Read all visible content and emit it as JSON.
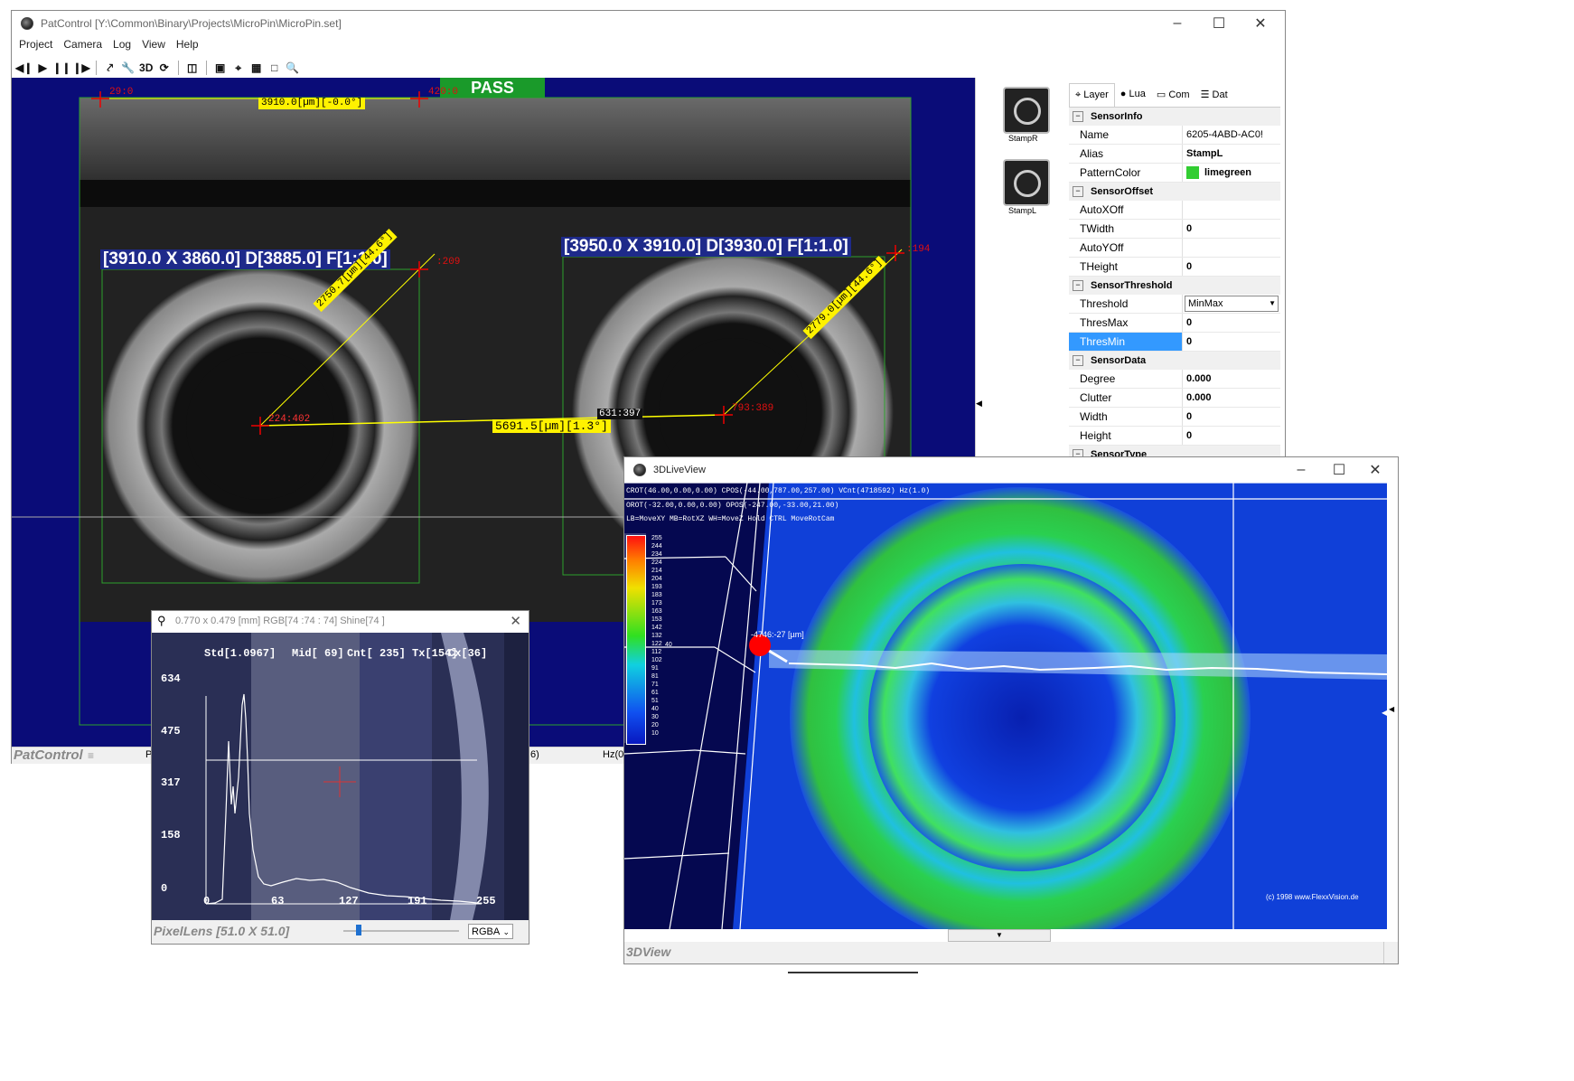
{
  "main_window": {
    "title": "PatControl [Y:\\Common\\Binary\\Projects\\MicroPin\\MicroPin.set]",
    "menu": [
      "Project",
      "Camera",
      "Log",
      "View",
      "Help"
    ],
    "toolbar": [
      "3D"
    ],
    "status_badge": "PASS",
    "status_color": "#1a9a2a",
    "top_measure": "3910.0[µm][-0.0°]",
    "point_left_top": "29:0",
    "point_right_top": "420:0",
    "left_pin_dims": "[3910.0 X 3860.0] D[3885.0] F[1:1.0]",
    "right_pin_dims": "[3950.0 X 3910.0] D[3930.0] F[1:1.0]",
    "left_radius": "2750.7[µm][44.6°]",
    "right_radius": "2779.0[µm][44.6°]",
    "center_dist": "5691.5[µm][1.3°]",
    "left_center": "224:402",
    "right_center": "793:389",
    "mid_point": "631:397",
    "left_edge_pt": ":209",
    "right_edge_pt": ":194",
    "statusbar_app": "PatControl",
    "statusbar_p": "P",
    "statusbar_mid": "6)",
    "statusbar_hz": "Hz(0."
  },
  "thumbnails": [
    {
      "label": "StampR"
    },
    {
      "label": "StampL"
    }
  ],
  "properties": {
    "tabs": [
      "Layer",
      "Lua",
      "Com",
      "Dat"
    ],
    "categories": [
      {
        "name": "SensorInfo",
        "rows": [
          {
            "k": "Name",
            "v": "6205-4ABD-AC0!"
          },
          {
            "k": "Alias",
            "v": "StampL"
          },
          {
            "k": "PatternColor",
            "v": "limegreen"
          }
        ]
      },
      {
        "name": "SensorOffset",
        "rows": [
          {
            "k": "AutoXOff",
            "v": ""
          },
          {
            "k": "TWidth",
            "v": "0"
          },
          {
            "k": "AutoYOff",
            "v": ""
          },
          {
            "k": "THeight",
            "v": "0"
          }
        ]
      },
      {
        "name": "SensorThreshold",
        "rows": [
          {
            "k": "Threshold",
            "v": "MinMax"
          },
          {
            "k": "ThresMax",
            "v": "0"
          },
          {
            "k": "ThresMin",
            "v": "0"
          }
        ]
      },
      {
        "name": "SensorData",
        "rows": [
          {
            "k": "Degree",
            "v": "0.000"
          },
          {
            "k": "Clutter",
            "v": "0.000"
          },
          {
            "k": "Width",
            "v": "0"
          },
          {
            "k": "Height",
            "v": "0"
          }
        ]
      },
      {
        "name": "SensorType",
        "rows": []
      }
    ],
    "pattern_color_hex": "#32cd32"
  },
  "pixel_lens": {
    "title": "0.770 x 0.479 [mm] RGB[74 :74 : 74] Shine[74 ]",
    "stats": {
      "std": "Std[1.0967]",
      "mid": "Mid[ 69]",
      "cnt": "Cnt[ 235] Tx[154]",
      "cx": "Cx[36]"
    },
    "y_ticks": [
      "634",
      "475",
      "317",
      "158",
      "0"
    ],
    "x_ticks": [
      "0",
      "63",
      "127",
      "191",
      "255"
    ],
    "statusbar": "PixelLens  [51.0 X 51.0]",
    "mode": "RGBA"
  },
  "live3d": {
    "title": "3DLiveView",
    "info1": "CROT(46.00,0.00,0.00) CPOS(-44.00,787.00,257.00) VCnt(4718592) Hz(1.0)",
    "info2": "OROT(-32.00,0.00,0.00) OPOS(-247.00,-33.00,21.00)",
    "info3": "LB=MoveXY MB=RotXZ WH=MoveZ Hold CTRL MoveRotCam",
    "probe": "-4746:-27 [µm]",
    "scale_values": [
      "255",
      "244",
      "234",
      "224",
      "214",
      "204",
      "193",
      "183",
      "173",
      "163",
      "153",
      "142",
      "132",
      "122",
      "112",
      "102",
      "91",
      "81",
      "71",
      "61",
      "51",
      "40",
      "30",
      "20",
      "10"
    ],
    "scale_marker": "40",
    "copyright": "(c) 1998 www.FlexxVision.de",
    "statusbar": "3DView"
  }
}
